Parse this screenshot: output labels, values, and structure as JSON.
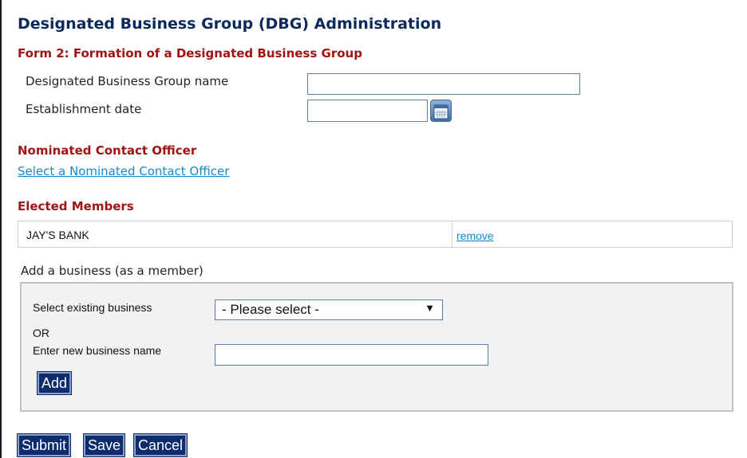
{
  "page": {
    "title": "Designated Business Group (DBG) Administration"
  },
  "form": {
    "heading": "Form 2: Formation of a Designated Business Group",
    "group_name_label": "Designated Business Group name",
    "group_name_value": "",
    "establishment_date_label": "Establishment date",
    "establishment_date_value": "",
    "calendar_icon": "calendar-icon"
  },
  "contact_officer": {
    "heading": "Nominated Contact Officer",
    "select_link": "Select a Nominated Contact Officer"
  },
  "elected_members": {
    "heading": "Elected Members",
    "rows": [
      {
        "name": "JAY'S BANK",
        "action": "remove"
      }
    ]
  },
  "add_business": {
    "label": "Add a business (as a member)",
    "select_existing_label": "Select existing business",
    "select_value": "- Please select -",
    "select_arrow": "▼",
    "or_label": "OR",
    "new_name_label": "Enter new business name",
    "new_name_value": "",
    "add_button": "Add"
  },
  "actions": {
    "submit": "Submit",
    "save": "Save",
    "cancel": "Cancel"
  },
  "colors": {
    "title": "#0b2a5b",
    "section_heading": "#a01414",
    "link": "#1a86c8",
    "button_bg": "#0d2c6e",
    "panel_bg": "#f2f2f2"
  }
}
